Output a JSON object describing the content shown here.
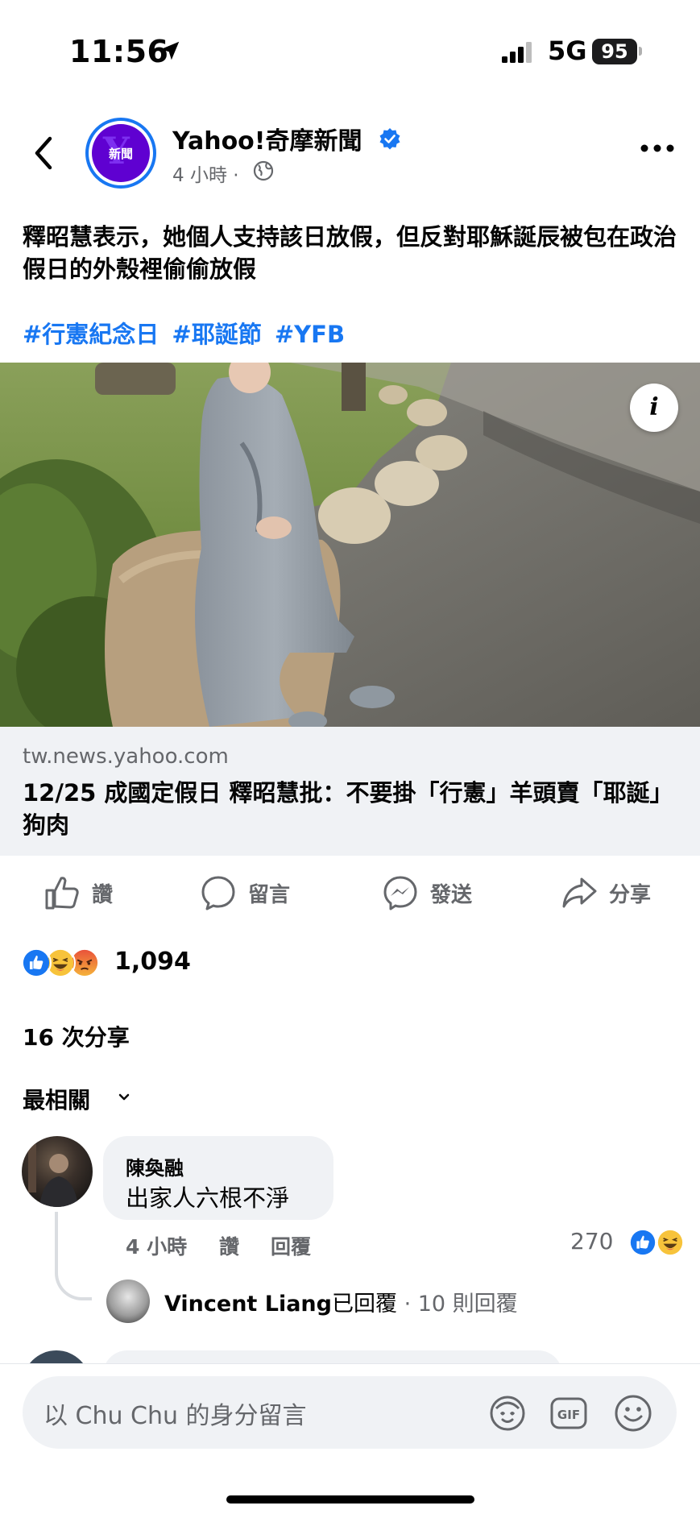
{
  "status_bar": {
    "time": "11:56",
    "network": "5G",
    "battery": "95"
  },
  "post": {
    "page_name": "Yahoo!奇摩新聞",
    "avatar_text": "新聞",
    "time": "4 小時 ·",
    "text": "釋昭慧表示，她個人支持該日放假，但反對耶穌誕辰被包在政治假日的外殼裡偷偷放假",
    "hashtags": [
      "#行憲紀念日",
      "#耶誕節",
      "#YFB"
    ],
    "info_label": "i"
  },
  "link": {
    "domain": "tw.news.yahoo.com",
    "title": "12/25 成國定假日 釋昭慧批：不要掛「行憲」羊頭賣「耶誕」狗肉"
  },
  "actions": {
    "like": "讚",
    "comment": "留言",
    "send": "發送",
    "share": "分享"
  },
  "stats": {
    "reactions_count": "1,094",
    "shares": "16 次分享"
  },
  "sort": {
    "label": "最相關"
  },
  "comment": {
    "author": "陳奐融",
    "text": "出家人六根不淨",
    "time": "4 小時",
    "like": "讚",
    "reply": "回覆",
    "likes": "270"
  },
  "reply_summary": {
    "name": "Vincent Liang",
    "action": "已回覆",
    "dot": " · ",
    "count": "10 則回覆"
  },
  "composer": {
    "placeholder": "以 Chu Chu 的身分留言",
    "gif": "GIF"
  },
  "colors": {
    "accent": "#1877f2",
    "secondary_text": "#65676b",
    "bubble": "#f0f2f5"
  }
}
